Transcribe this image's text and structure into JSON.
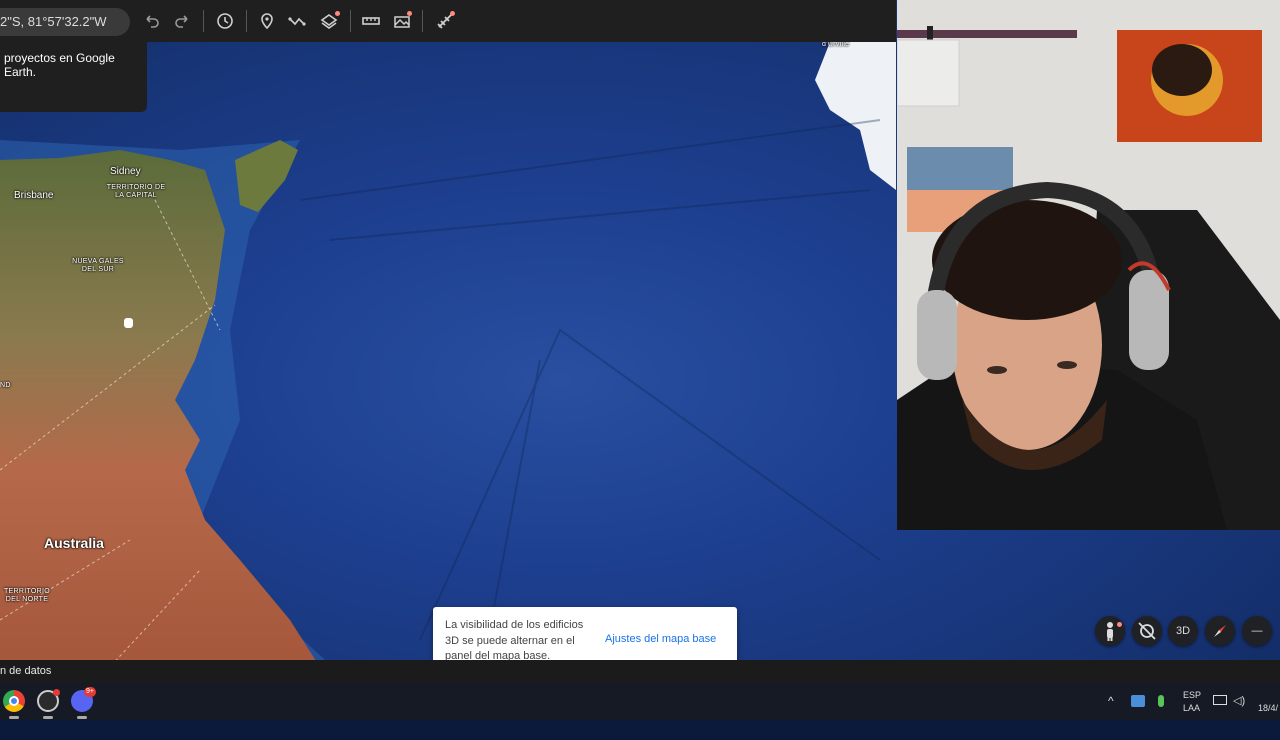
{
  "toolbar": {
    "coords": "2\"S, 81°57'32.2\"W",
    "icons": [
      "undo-icon",
      "redo-icon",
      "history-icon",
      "placemark-icon",
      "path-icon",
      "layers-icon",
      "ruler-icon",
      "image-overlay-icon",
      "satellite-icon"
    ]
  },
  "tooltip": {
    "text": "proyectos en Google Earth."
  },
  "map_labels": {
    "sidney": "Sidney",
    "brisbane": "Brisbane",
    "act": "TERRITORIO DE LA CAPITAL",
    "nsw": "NUEVA GALES DEL SUR",
    "australia": "Australia",
    "nt": "TERRITORIO DEL NORTE",
    "durville": "d'Urville",
    "edge": "ND"
  },
  "snackbar": {
    "text": "La visibilidad de los edificios 3D se puede alternar en el panel del mapa base.",
    "action": "Ajustes del mapa base"
  },
  "controls": {
    "mode_3d": "3D",
    "zoom_out": "—"
  },
  "footer": {
    "text": "n de datos"
  },
  "taskbar": {
    "apps": [
      "chrome-icon",
      "obs-icon",
      "discord-icon"
    ],
    "discord_badge": "9+",
    "lang_top": "ESP",
    "lang_bottom": "LAA",
    "date": "18/4/"
  },
  "colors": {
    "ocean": "#1d3f8f",
    "toolbar": "#1f1f1f",
    "link": "#1a73e8",
    "land": "#b5694a"
  }
}
